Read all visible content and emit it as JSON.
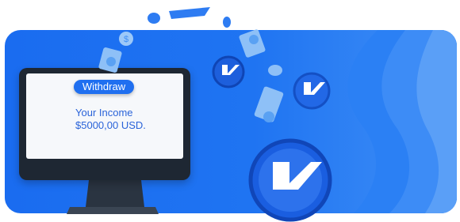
{
  "card": {
    "withdraw_label": "Withdraw",
    "income_label": "Your Income",
    "income_value": "$5000,00 USD."
  },
  "icons": {
    "coin": "k-logo-coin-icon",
    "bill": "dollar-bill-icon"
  },
  "colors": {
    "banner_blue": "#1a6cf0",
    "button_blue": "#1f6ff0",
    "text_blue": "#2a63d9",
    "monitor_dark": "#1e2733"
  }
}
